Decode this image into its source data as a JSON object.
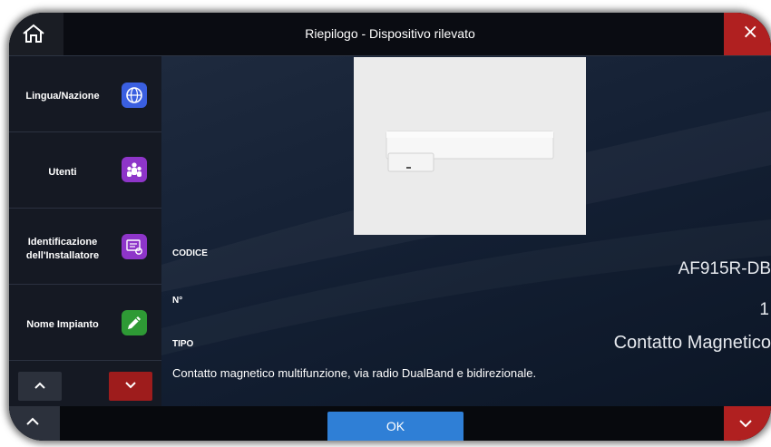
{
  "header": {
    "title": "Riepilogo - Dispositivo rilevato",
    "home_icon": "home-icon",
    "close_label": "×"
  },
  "sidebar": {
    "items": [
      {
        "label_lines": [
          "Lingua/Nazione"
        ],
        "icon": "globe-icon",
        "icon_color": "#3a5fe0"
      },
      {
        "label_lines": [
          "Utenti"
        ],
        "icon": "users-icon",
        "icon_color": "#8e35c9"
      },
      {
        "label_lines": [
          "Identificazione",
          "dell'Installatore"
        ],
        "icon": "installer-id-icon",
        "icon_color": "#8e35c9"
      },
      {
        "label_lines": [
          "Nome Impianto"
        ],
        "icon": "pencil-icon",
        "icon_color": "#2e9a35"
      }
    ],
    "nav": {
      "up_icon": "chevron-up-icon",
      "down_icon": "chevron-down-icon"
    }
  },
  "device": {
    "codice_label": "CODICE",
    "codice_value": "AF915R-DB",
    "numero_label": "N°",
    "numero_value": "1",
    "tipo_label": "TIPO",
    "tipo_value": "Contatto Magnetico",
    "description": "Contatto magnetico multifunzione, via radio DualBand e bidirezionale."
  },
  "footer": {
    "ok_label": "OK",
    "left_icon": "chevron-up-icon",
    "right_icon": "chevron-down-icon"
  },
  "colors": {
    "accent_blue": "#2f7fd6",
    "danger_red": "#b02020",
    "background": "#0e1624"
  }
}
